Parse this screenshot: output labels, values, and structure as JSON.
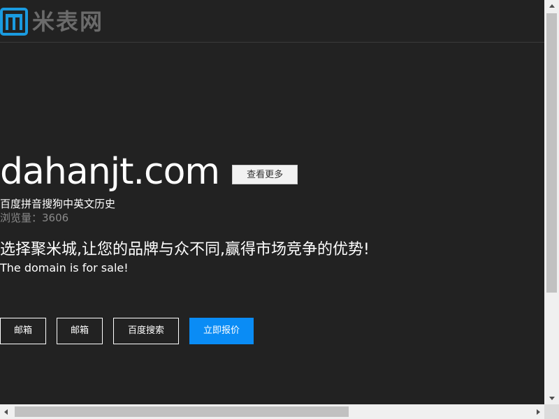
{
  "header": {
    "logo_text": "米表网",
    "logo_icon": "mibiao-logo-icon",
    "logo_color": "#1a9be0"
  },
  "domain": {
    "name": "dahanjt.com",
    "more_button": "查看更多",
    "description": "百度拼音搜狗中英文历史",
    "views_label": "浏览量：",
    "views_count": "3606"
  },
  "sale": {
    "slogan": "选择聚米城,让您的品牌与众不同,赢得市场竞争的优势!",
    "notice": "The domain is for sale!"
  },
  "actions": [
    {
      "label": "邮箱"
    },
    {
      "label": "邮箱"
    },
    {
      "label": "百度搜索"
    },
    {
      "label": "立即报价"
    }
  ],
  "colors": {
    "background": "#222222",
    "primary_button": "#0a8cf5"
  }
}
